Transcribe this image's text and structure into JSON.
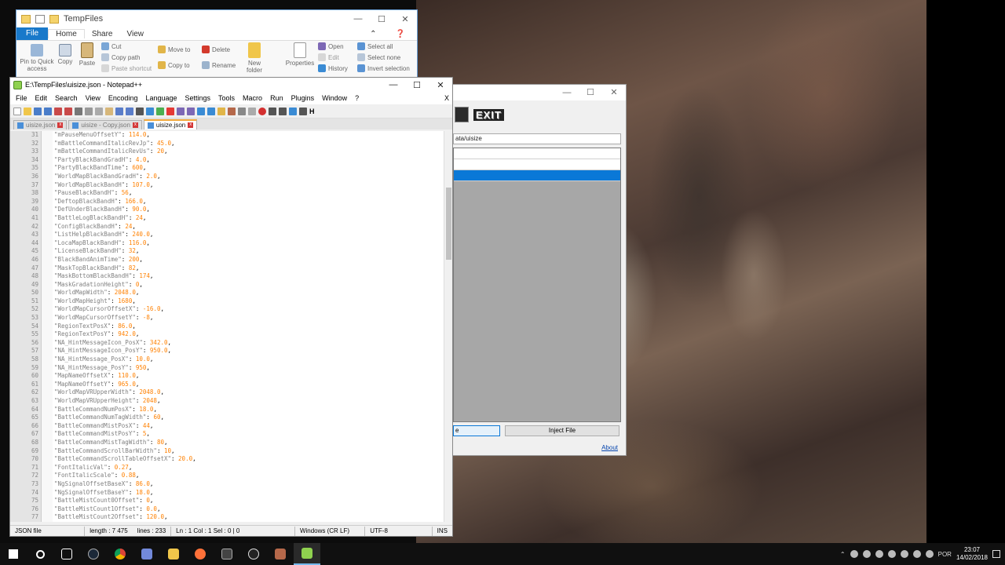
{
  "explorer": {
    "title": "TempFiles",
    "tabs": [
      "File",
      "Home",
      "Share",
      "View"
    ],
    "ribbon": {
      "pin": "Pin to Quick access",
      "copy": "Copy",
      "paste": "Paste",
      "cut": "Cut",
      "copy_path": "Copy path",
      "paste_shortcut": "Paste shortcut",
      "move_to": "Move to",
      "copy_to": "Copy to",
      "delete": "Delete",
      "rename": "Rename",
      "new_folder": "New folder",
      "properties": "Properties",
      "open": "Open",
      "edit": "Edit",
      "history": "History",
      "select_all": "Select all",
      "select_none": "Select none",
      "invert_selection": "Invert selection"
    }
  },
  "tool": {
    "logo_text": "EXIT",
    "path": "ata/uisize",
    "btn_left": "e",
    "btn_inject": "Inject File",
    "about": "About"
  },
  "npp": {
    "title": "E:\\TempFiles\\uisize.json - Notepad++",
    "menu": [
      "File",
      "Edit",
      "Search",
      "View",
      "Encoding",
      "Language",
      "Settings",
      "Tools",
      "Macro",
      "Run",
      "Plugins",
      "Window",
      "?"
    ],
    "menu_close": "X",
    "tabs": [
      {
        "label": "uisize.json",
        "active": false
      },
      {
        "label": "uisize - Copy.json",
        "active": false
      },
      {
        "label": "uisize.json",
        "active": true
      }
    ],
    "lines": [
      {
        "n": "31",
        "k": "\"mPauseMenuOffsetY\"",
        "v": "114.0"
      },
      {
        "n": "32",
        "k": "\"mBattleCommandItalicRevJp\"",
        "v": "45.0"
      },
      {
        "n": "33",
        "k": "\"mBattleCommandItalicRevUs\"",
        "v": "20"
      },
      {
        "n": "34",
        "k": "\"PartyBlackBandGradH\"",
        "v": "4.0"
      },
      {
        "n": "35",
        "k": "\"PartyBlackBandTime\"",
        "v": "600"
      },
      {
        "n": "36",
        "k": "\"WorldMapBlackBandGradH\"",
        "v": "2.0"
      },
      {
        "n": "37",
        "k": "\"WorldMapBlackBandH\"",
        "v": "107.0"
      },
      {
        "n": "38",
        "k": "\"PauseBlackBandH\"",
        "v": "56"
      },
      {
        "n": "39",
        "k": "\"DeftopBlackBandH\"",
        "v": "166.0"
      },
      {
        "n": "40",
        "k": "\"DefUnderBlackBandH\"",
        "v": "90.0"
      },
      {
        "n": "41",
        "k": "\"BattleLogBlackBandH\"",
        "v": "24"
      },
      {
        "n": "42",
        "k": "\"ConfigBlackBandH\"",
        "v": "24"
      },
      {
        "n": "43",
        "k": "\"ListHelpBlackBandH\"",
        "v": "240.0"
      },
      {
        "n": "44",
        "k": "\"LocaMapBlackBandH\"",
        "v": "116.0"
      },
      {
        "n": "45",
        "k": "\"LicenseBlackBandH\"",
        "v": "32"
      },
      {
        "n": "46",
        "k": "\"BlackBandAnimTime\"",
        "v": "200"
      },
      {
        "n": "47",
        "k": "\"MaskTopBlackBandH\"",
        "v": "82"
      },
      {
        "n": "48",
        "k": "\"MaskBottomBlackBandH\"",
        "v": "174"
      },
      {
        "n": "49",
        "k": "\"MaskGradationHeight\"",
        "v": "0"
      },
      {
        "n": "50",
        "k": "\"WorldMapWidth\"",
        "v": "2048.0"
      },
      {
        "n": "51",
        "k": "\"WorldMapHeight\"",
        "v": "1680"
      },
      {
        "n": "52",
        "k": "\"WorldMapCursorOffsetX\"",
        "v": "-16.0"
      },
      {
        "n": "53",
        "k": "\"WorldMapCursorOffsetY\"",
        "v": "-8"
      },
      {
        "n": "54",
        "k": "\"RegionTextPosX\"",
        "v": "86.0"
      },
      {
        "n": "55",
        "k": "\"RegionTextPosY\"",
        "v": "942.0"
      },
      {
        "n": "56",
        "k": "\"NA_HintMessageIcon_PosX\"",
        "v": "342.0"
      },
      {
        "n": "57",
        "k": "\"NA_HintMessageIcon_PosY\"",
        "v": "950.0"
      },
      {
        "n": "58",
        "k": "\"NA_HintMessage_PosX\"",
        "v": "10.0"
      },
      {
        "n": "59",
        "k": "\"NA_HintMessage_PosY\"",
        "v": "950"
      },
      {
        "n": "60",
        "k": "\"MapNameOffsetX\"",
        "v": "110.0"
      },
      {
        "n": "61",
        "k": "\"MapNameOffsetY\"",
        "v": "965.0"
      },
      {
        "n": "62",
        "k": "\"WorldMapVRUpperWidth\"",
        "v": "2048.0"
      },
      {
        "n": "63",
        "k": "\"WorldMapVRUpperHeight\"",
        "v": "2048"
      },
      {
        "n": "64",
        "k": "\"BattleCommandNumPosX\"",
        "v": "18.0"
      },
      {
        "n": "65",
        "k": "\"BattleCommandNumTagWidth\"",
        "v": "60"
      },
      {
        "n": "66",
        "k": "\"BattleCommandMistPosX\"",
        "v": "44"
      },
      {
        "n": "67",
        "k": "\"BattleCommandMistPosY\"",
        "v": "5"
      },
      {
        "n": "68",
        "k": "\"BattleCommandMistTagWidth\"",
        "v": "80"
      },
      {
        "n": "69",
        "k": "\"BattleCommandScrollBarWidth\"",
        "v": "10"
      },
      {
        "n": "70",
        "k": "\"BattleCommandScrollTableOffsetX\"",
        "v": "20.0"
      },
      {
        "n": "71",
        "k": "\"FontItalicVal\"",
        "v": "0.27"
      },
      {
        "n": "72",
        "k": "\"FontItalicScale\"",
        "v": "0.88"
      },
      {
        "n": "73",
        "k": "\"NgSignalOffsetBaseX\"",
        "v": "86.0"
      },
      {
        "n": "74",
        "k": "\"NgSignalOffsetBaseY\"",
        "v": "18.0"
      },
      {
        "n": "75",
        "k": "\"BattleMistCount0Offset\"",
        "v": "0"
      },
      {
        "n": "76",
        "k": "\"BattleMistCount1Offset\"",
        "v": "0.0"
      },
      {
        "n": "77",
        "k": "\"BattleMistCount2Offset\"",
        "v": "120.0"
      }
    ],
    "status": {
      "filetype": "JSON file",
      "length": "length : 7 475",
      "lines": "lines : 233",
      "pos": "Ln : 1    Col : 1    Sel : 0 | 0",
      "eol": "Windows (CR LF)",
      "encoding": "UTF-8",
      "mode": "INS"
    }
  },
  "taskbar": {
    "lang": "POR",
    "time": "23:07",
    "date": "14/02/2018"
  }
}
